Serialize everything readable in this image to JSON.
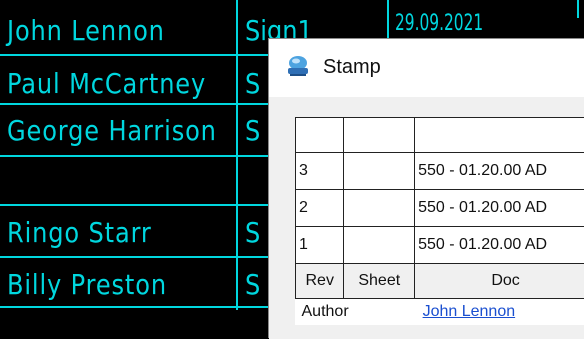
{
  "drawing": {
    "names": [
      "John Lennon",
      "Paul McCartney",
      "George Harrison",
      "",
      "Ringo Starr",
      "Billy Preston"
    ],
    "signs": [
      "Sign1",
      "S",
      "S",
      "",
      "S",
      "S"
    ],
    "date": "29.09.2021",
    "line_color": "#00d7df",
    "background": "#000000"
  },
  "dialog": {
    "title": "Stamp",
    "icon": "stamp-app-icon",
    "rows": [
      {
        "rev": "",
        "sheet": "",
        "doc": ""
      },
      {
        "rev": "3",
        "sheet": "",
        "doc": "550 - 01.20.00 AD"
      },
      {
        "rev": "2",
        "sheet": "",
        "doc": "550 - 01.20.00 AD"
      },
      {
        "rev": "1",
        "sheet": "",
        "doc": "550 - 01.20.00 AD"
      }
    ],
    "headers": {
      "rev": "Rev",
      "sheet": "Sheet",
      "doc": "Doc"
    },
    "author_label": "Author",
    "author_value": "John Lennon"
  }
}
